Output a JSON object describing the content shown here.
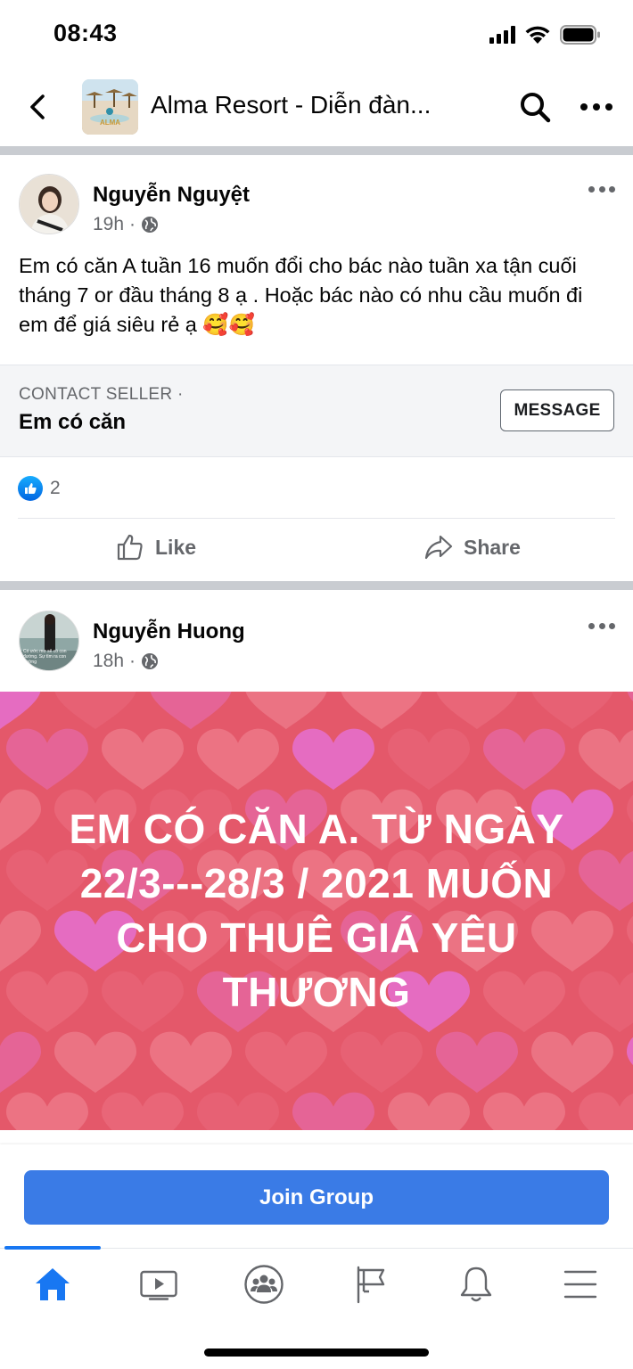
{
  "status_bar": {
    "time": "08:43"
  },
  "header": {
    "title": "Alma Resort - Diễn đàn...",
    "thumb_text": "ALMA"
  },
  "posts": [
    {
      "author": "Nguyễn Nguyệt",
      "time": "19h",
      "separator": "·",
      "text": "Em có căn A tuần 16 muốn đổi cho bác nào tuần xa tận cuối tháng 7 or đầu tháng 8 ạ . Hoặc  bác nào có nhu cầu muốn đi em để giá siêu rẻ ạ 🥰🥰",
      "contact_label": "CONTACT SELLER ·",
      "contact_title": "Em có căn",
      "message_label": "MESSAGE",
      "reaction_count": "2",
      "like_label": "Like",
      "share_label": "Share"
    },
    {
      "author": "Nguyễn Huong",
      "time": "18h",
      "separator": "·",
      "banner_text": "EM CÓ  CĂN  A. TỪ NGÀY  22/3---28/3 / 2021 MUỐN  CHO THUÊ GIÁ  YÊU  THƯƠNG",
      "avatar_caption": "Có ước mơ sẽ có con đường. Sự tìm ra con đường"
    }
  ],
  "join_label": "Join Group",
  "tabs": [
    "home-icon",
    "video-icon",
    "groups-icon",
    "pages-flag-icon",
    "notifications-bell-icon",
    "menu-icon"
  ],
  "colors": {
    "accent": "#1877f2",
    "join_button": "#3a7be6",
    "banner_bg": "#e4586a",
    "secondary_text": "#65676b"
  }
}
